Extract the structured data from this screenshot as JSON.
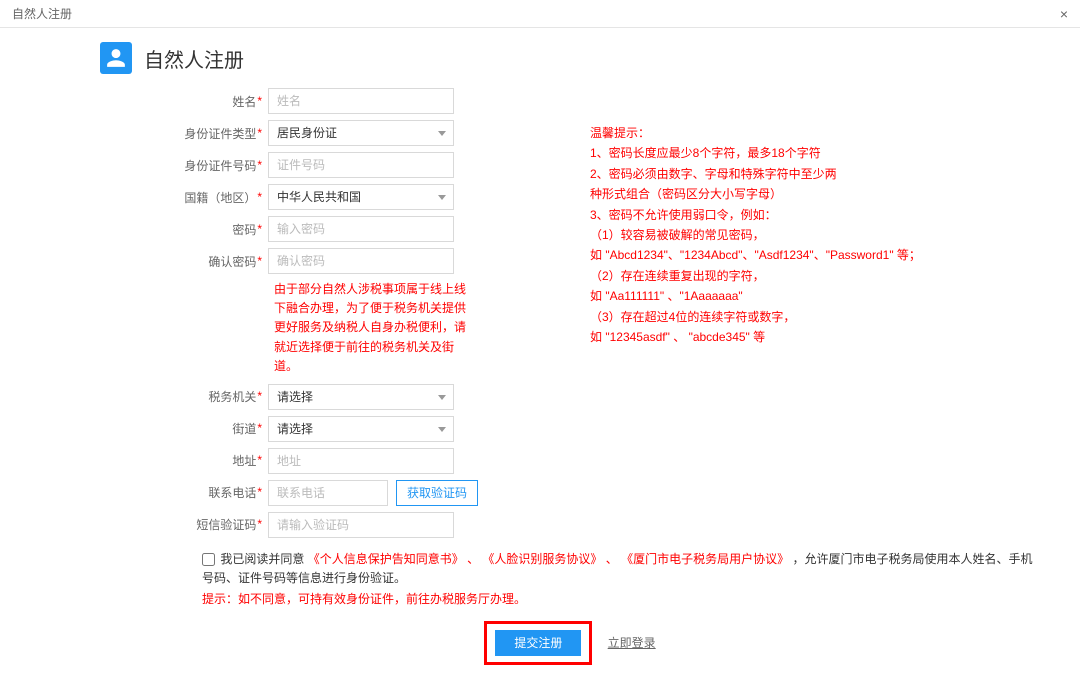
{
  "modal": {
    "title": "自然人注册",
    "close": "×"
  },
  "header": {
    "title": "自然人注册"
  },
  "labels": {
    "name": "姓名",
    "idType": "身份证件类型",
    "idNo": "身份证件号码",
    "nation": "国籍（地区）",
    "pwd": "密码",
    "pwd2": "确认密码",
    "taxOrg": "税务机关",
    "street": "街道",
    "addr": "地址",
    "phone": "联系电话",
    "smsCode": "短信验证码"
  },
  "placeholders": {
    "name": "姓名",
    "idNo": "证件号码",
    "pwd": "输入密码",
    "pwd2": "确认密码",
    "addr": "地址",
    "phone": "联系电话",
    "smsCode": "请输入验证码"
  },
  "selects": {
    "idType": "居民身份证",
    "nation": "中华人民共和国",
    "taxOrg": "请选择",
    "street": "请选择"
  },
  "buttons": {
    "getCode": "获取验证码",
    "submit": "提交注册",
    "loginNow": "立即登录"
  },
  "taxNote": "由于部分自然人涉税事项属于线上线下融合办理，为了便于税务机关提供更好服务及纳税人自身办税便利，请就近选择便于前往的税务机关及街道。",
  "tips": {
    "t0": "温馨提示：",
    "t1": "1、密码长度应最少8个字符，最多18个字符",
    "t2": "2、密码必须由数字、字母和特殊字符中至少两",
    "t2b": "种形式组合（密码区分大小写字母）",
    "t3": "3、密码不允许使用弱口令，例如：",
    "t3a": "（1）较容易被破解的常见密码，",
    "t3a2": "如 \"Abcd1234\"、\"1234Abcd\"、\"Asdf1234\"、\"Password1\" 等；",
    "t3b": "（2）存在连续重复出现的字符，",
    "t3b2": "如 \"Aa111111\" 、\"1Aaaaaaa\"",
    "t3c": "（3）存在超过4位的连续字符或数字，",
    "t3c2": "如 \"12345asdf\" 、 \"abcde345\" 等"
  },
  "agreement": {
    "pre": "我已阅读并同意",
    "a1": "《个人信息保护告知同意书》",
    "sep": "、",
    "a2": "《人脸识别服务协议》",
    "a3": "《厦门市电子税务局用户协议》",
    "post": "，允许厦门市电子税务局使用本人姓名、手机号码、证件号码等信息进行身份验证。"
  },
  "disagreeNote": "提示：如不同意，可持有效身份证件，前往办税服务厅办理。"
}
